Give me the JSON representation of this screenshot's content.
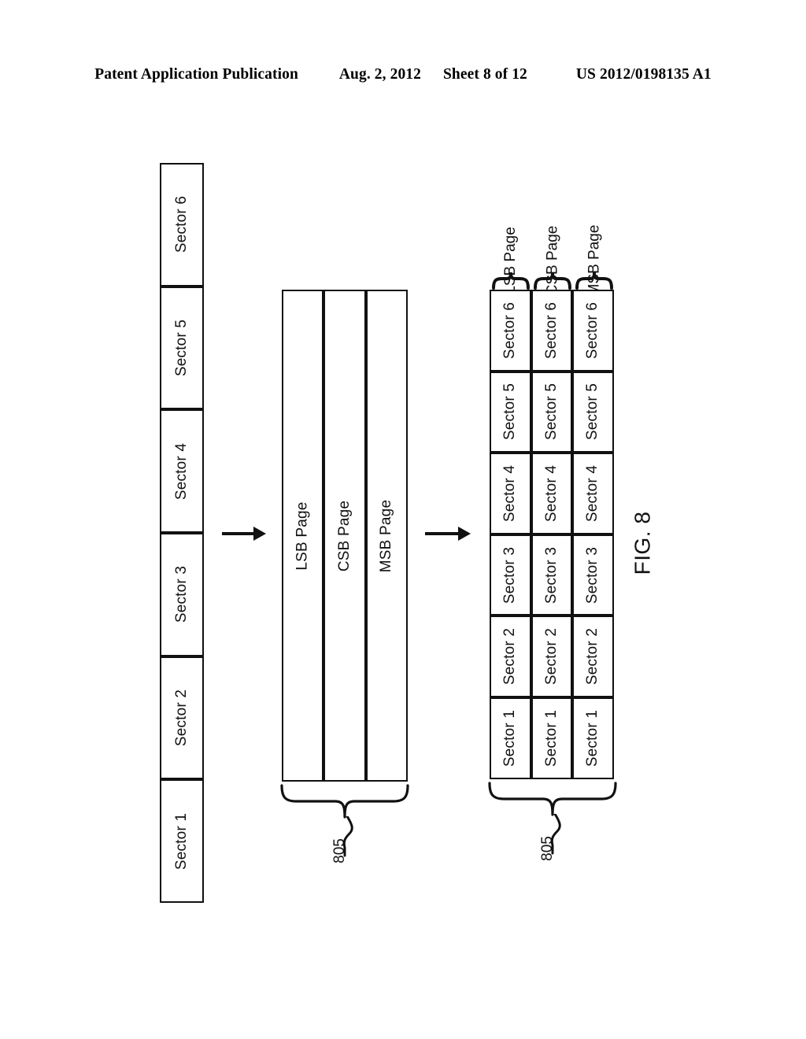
{
  "header": {
    "publication": "Patent Application Publication",
    "date": "Aug. 2, 2012",
    "sheet": "Sheet 8 of 12",
    "patent_number": "US 2012/0198135 A1"
  },
  "figure": {
    "caption": "FIG. 8",
    "input_column": {
      "name": "sector-column",
      "cells": [
        "Sector 1",
        "Sector 2",
        "Sector 3",
        "Sector 4",
        "Sector 5",
        "Sector 6"
      ]
    },
    "page_strip": {
      "name": "page-strip",
      "cells": [
        "LSB Page",
        "CSB Page",
        "MSB Page"
      ],
      "reference_numeral": "805"
    },
    "sector_grid": {
      "name": "sector-grid",
      "column_labels": [
        "LSB Page",
        "CSB Page",
        "MSB Page"
      ],
      "row_labels": [
        "Sector 1",
        "Sector 2",
        "Sector 3",
        "Sector 4",
        "Sector 5",
        "Sector 6"
      ],
      "reference_numeral": "805",
      "rows": [
        [
          "Sector 1",
          "Sector 1",
          "Sector 1"
        ],
        [
          "Sector 2",
          "Sector 2",
          "Sector 2"
        ],
        [
          "Sector 3",
          "Sector 3",
          "Sector 3"
        ],
        [
          "Sector 4",
          "Sector 4",
          "Sector 4"
        ],
        [
          "Sector 5",
          "Sector 5",
          "Sector 5"
        ],
        [
          "Sector 6",
          "Sector 6",
          "Sector 6"
        ]
      ]
    },
    "arrows": [
      {
        "name": "arrow-input-to-pages"
      },
      {
        "name": "arrow-pages-to-grid"
      }
    ],
    "colors": {
      "ink": "#111111",
      "paper": "#ffffff"
    }
  }
}
